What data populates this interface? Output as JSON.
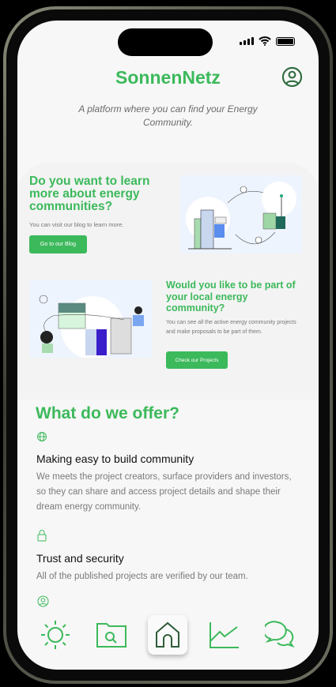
{
  "app": {
    "title": "SonnenNetz",
    "subtitle": "A platform where you can find your Energy Community."
  },
  "blog_card": {
    "title": "Do you want to learn more about energy communities?",
    "text": "You can visit our blog to learn more.",
    "button": "Go to our Blog"
  },
  "projects_card": {
    "title": "Would you like to be part of your local energy community?",
    "text": "You can see all the active energy community projects and make proposals to be part of them.",
    "button": "Check our Projects"
  },
  "offer": {
    "title": "What do we offer?",
    "features": [
      {
        "icon": "globe-icon",
        "title": "Making easy to build community",
        "text": "We meets the project creators, surface providers and investors, so they can share and access project details and shape their dream energy community."
      },
      {
        "icon": "lock-icon",
        "title": "Trust and security",
        "text": "All of the published projects are verified by our team."
      },
      {
        "icon": "user-circle-icon"
      }
    ]
  },
  "nav": {
    "items": [
      "sun-icon",
      "folder-search-icon",
      "home-icon",
      "chart-icon",
      "chat-icon"
    ],
    "active": "home-icon"
  },
  "colors": {
    "accent": "#3cb95b",
    "background": "#f7f7f7"
  }
}
